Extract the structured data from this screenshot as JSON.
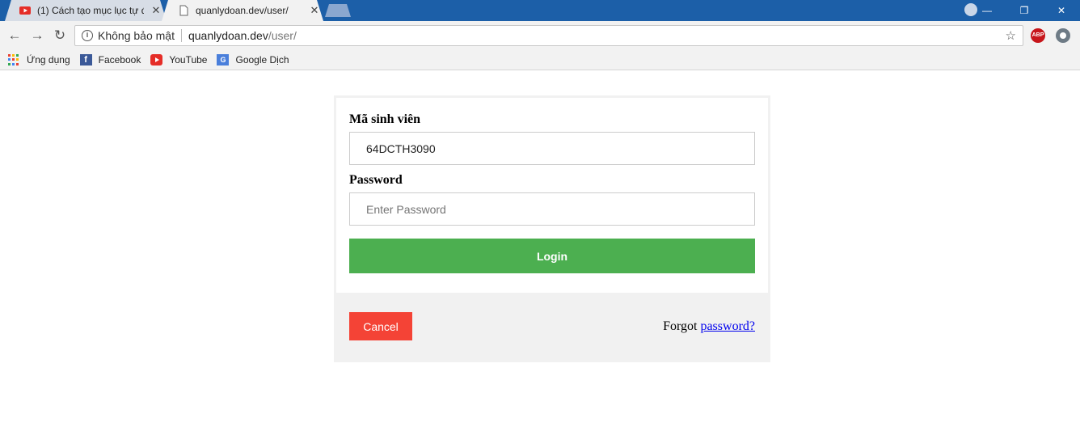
{
  "browser": {
    "tabs": [
      {
        "title": "(1) Cách tạo mục lục tự đ",
        "close": "✕",
        "favicon": "youtube-icon"
      },
      {
        "title": "quanlydoan.dev/user/",
        "close": "✕",
        "favicon": "page-icon"
      }
    ],
    "window_controls": {
      "minimize": "—",
      "restore": "❐",
      "close": "✕"
    },
    "nav": {
      "back": "←",
      "forward": "→",
      "reload": "↻"
    },
    "address": {
      "security_label": "Không bảo mật",
      "host": "quanlydoan.dev",
      "path": "/user/"
    },
    "extensions": {
      "adblock": "ABP"
    },
    "bookmarks": [
      {
        "label": "Ứng dụng",
        "icon": "apps-icon"
      },
      {
        "label": "Facebook",
        "icon": "facebook-icon"
      },
      {
        "label": "YouTube",
        "icon": "youtube-icon"
      },
      {
        "label": "Google Dịch",
        "icon": "google-translate-icon"
      }
    ]
  },
  "login_form": {
    "student_id_label": "Mã sinh viên",
    "student_id_value": "64DCTH3090",
    "password_label": "Password",
    "password_placeholder": "Enter Password",
    "login_button": "Login",
    "cancel_button": "Cancel",
    "forgot_text": "Forgot",
    "forgot_link": "password?"
  },
  "colors": {
    "login_button": "#4caf50",
    "cancel_button": "#f44336",
    "title_bar": "#1c5fa8",
    "link": "#0000ee"
  }
}
